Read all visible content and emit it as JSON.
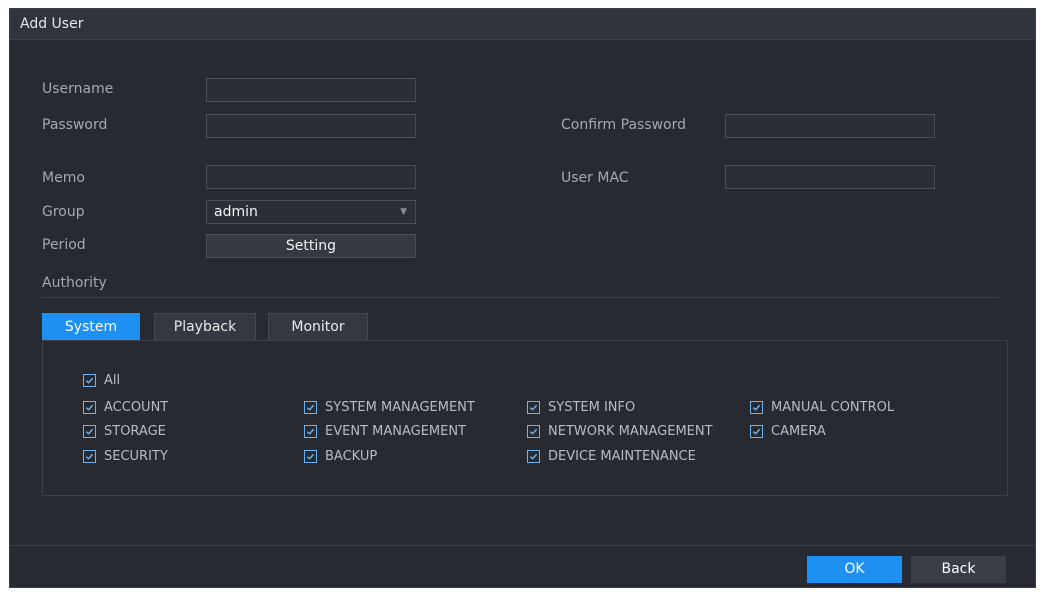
{
  "dialog": {
    "title": "Add User"
  },
  "form": {
    "username": {
      "label": "Username",
      "value": ""
    },
    "password": {
      "label": "Password",
      "value": ""
    },
    "confirm_password": {
      "label": "Confirm Password",
      "value": ""
    },
    "memo": {
      "label": "Memo",
      "value": ""
    },
    "user_mac": {
      "label": "User MAC",
      "value": ""
    },
    "group": {
      "label": "Group",
      "value": "admin"
    },
    "period": {
      "label": "Period",
      "button": "Setting"
    }
  },
  "authority": {
    "label": "Authority",
    "tabs": [
      {
        "label": "System",
        "active": true
      },
      {
        "label": "Playback",
        "active": false
      },
      {
        "label": "Monitor",
        "active": false
      }
    ],
    "all": {
      "label": "All",
      "checked": true
    },
    "items": [
      {
        "label": "ACCOUNT",
        "checked": true
      },
      {
        "label": "SYSTEM MANAGEMENT",
        "checked": true
      },
      {
        "label": "SYSTEM INFO",
        "checked": true
      },
      {
        "label": "MANUAL CONTROL",
        "checked": true
      },
      {
        "label": "STORAGE",
        "checked": true
      },
      {
        "label": "EVENT MANAGEMENT",
        "checked": true
      },
      {
        "label": "NETWORK MANAGEMENT",
        "checked": true
      },
      {
        "label": "CAMERA",
        "checked": true
      },
      {
        "label": "SECURITY",
        "checked": true
      },
      {
        "label": "BACKUP",
        "checked": true
      },
      {
        "label": "DEVICE MAINTENANCE",
        "checked": true
      }
    ]
  },
  "buttons": {
    "ok": "OK",
    "back": "Back"
  },
  "colors": {
    "accent": "#1e90f2",
    "background": "#272a31",
    "checkbox": "#6fb2f0"
  },
  "icons": {
    "checkbox": "check-icon",
    "dropdown": "chevron-down-icon"
  }
}
